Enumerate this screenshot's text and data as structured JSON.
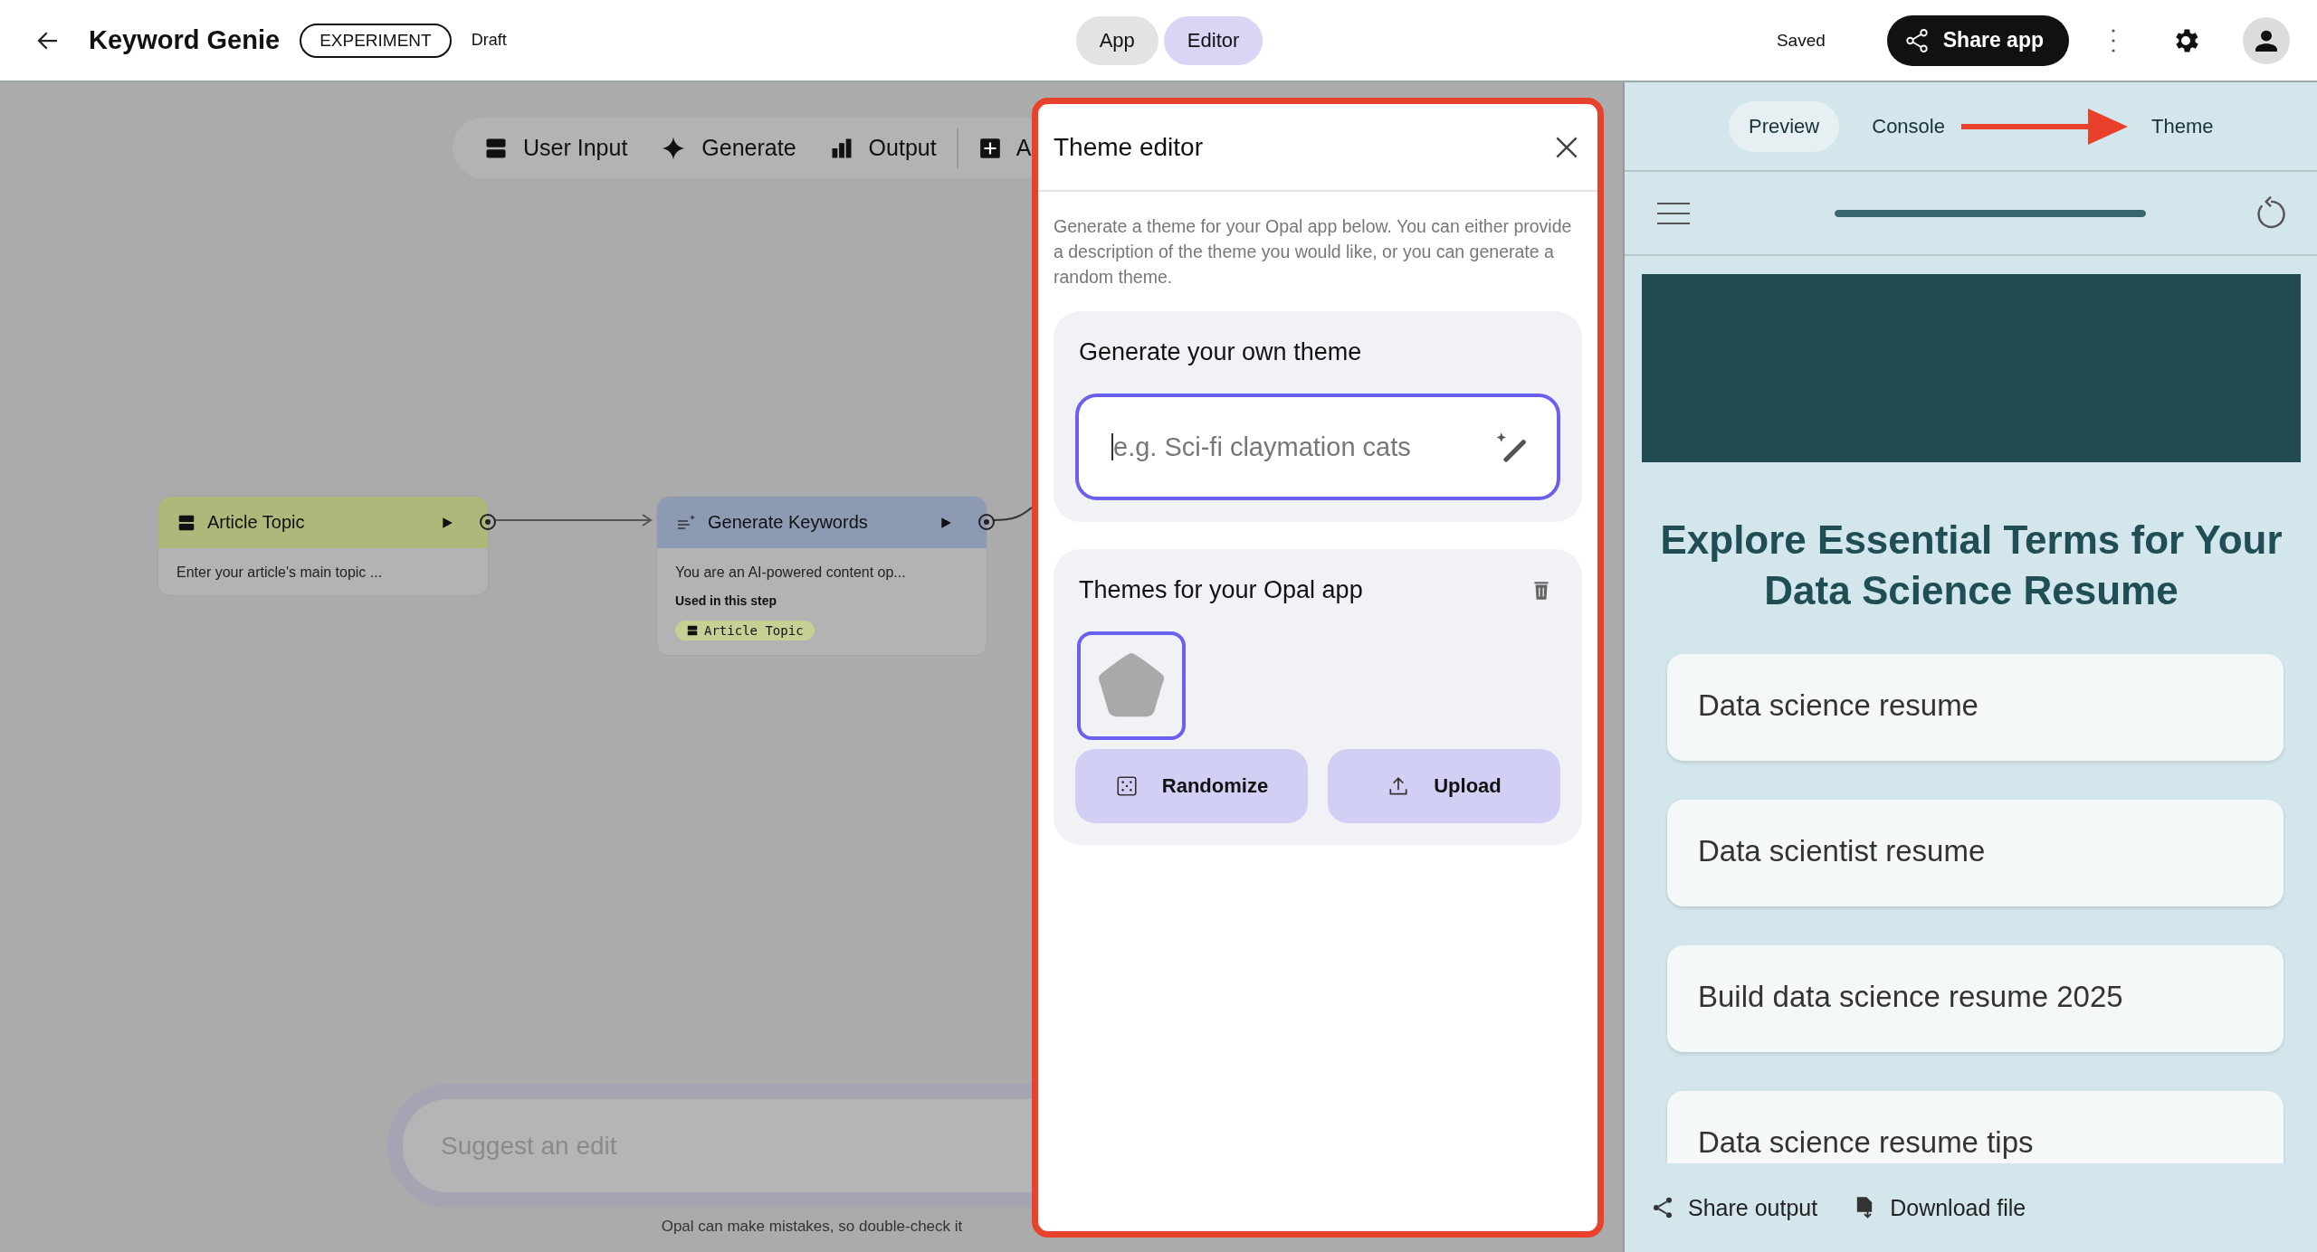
{
  "header": {
    "title": "Keyword Genie",
    "badge": "EXPERIMENT",
    "status": "Draft",
    "mode_toggle": [
      {
        "label": "App",
        "selected": false
      },
      {
        "label": "Editor",
        "selected": true
      }
    ],
    "save_status": "Saved",
    "share_button": "Share app"
  },
  "canvas": {
    "toolbar": [
      {
        "label": "User Input",
        "kind": "input"
      },
      {
        "label": "Generate",
        "kind": "generate"
      },
      {
        "label": "Output",
        "kind": "output"
      },
      {
        "label": "A",
        "kind": "add"
      }
    ],
    "nodes": [
      {
        "kind": "input",
        "title": "Article Topic",
        "body": "Enter your article's main topic ..."
      },
      {
        "kind": "generate",
        "title": "Generate Keywords",
        "body": "You are an AI-powered content op...",
        "used_label": "Used in this step",
        "used_chips": [
          "Article Topic"
        ]
      }
    ],
    "suggest": {
      "placeholder": "Suggest an edit"
    },
    "disclaimer": "Opal can make mistakes, so double-check it"
  },
  "theme_editor": {
    "title": "Theme editor",
    "description": "Generate a theme for your Opal app below. You can either provide a description of the theme you would like, or you can generate a random theme.",
    "generate_card": {
      "title": "Generate your own theme",
      "placeholder": "e.g. Sci-fi claymation cats"
    },
    "themes_card": {
      "title": "Themes for your Opal app",
      "themes": [
        {
          "selected": true
        }
      ],
      "buttons": [
        {
          "label": "Randomize",
          "kind": "randomize"
        },
        {
          "label": "Upload",
          "kind": "upload"
        }
      ]
    }
  },
  "preview": {
    "tabs": [
      {
        "label": "Preview",
        "selected": true
      },
      {
        "label": "Console",
        "selected": false
      },
      {
        "label": "Theme",
        "selected": false
      }
    ],
    "progress": {
      "level": 1
    },
    "heading": "Explore Essential Terms for Your Data Science Resume",
    "results": [
      "Data science resume",
      "Data scientist resume",
      "Build data science resume 2025",
      "Data science resume tips"
    ],
    "actions": [
      {
        "label": "Share output",
        "kind": "share"
      },
      {
        "label": "Download file",
        "kind": "download"
      }
    ]
  }
}
